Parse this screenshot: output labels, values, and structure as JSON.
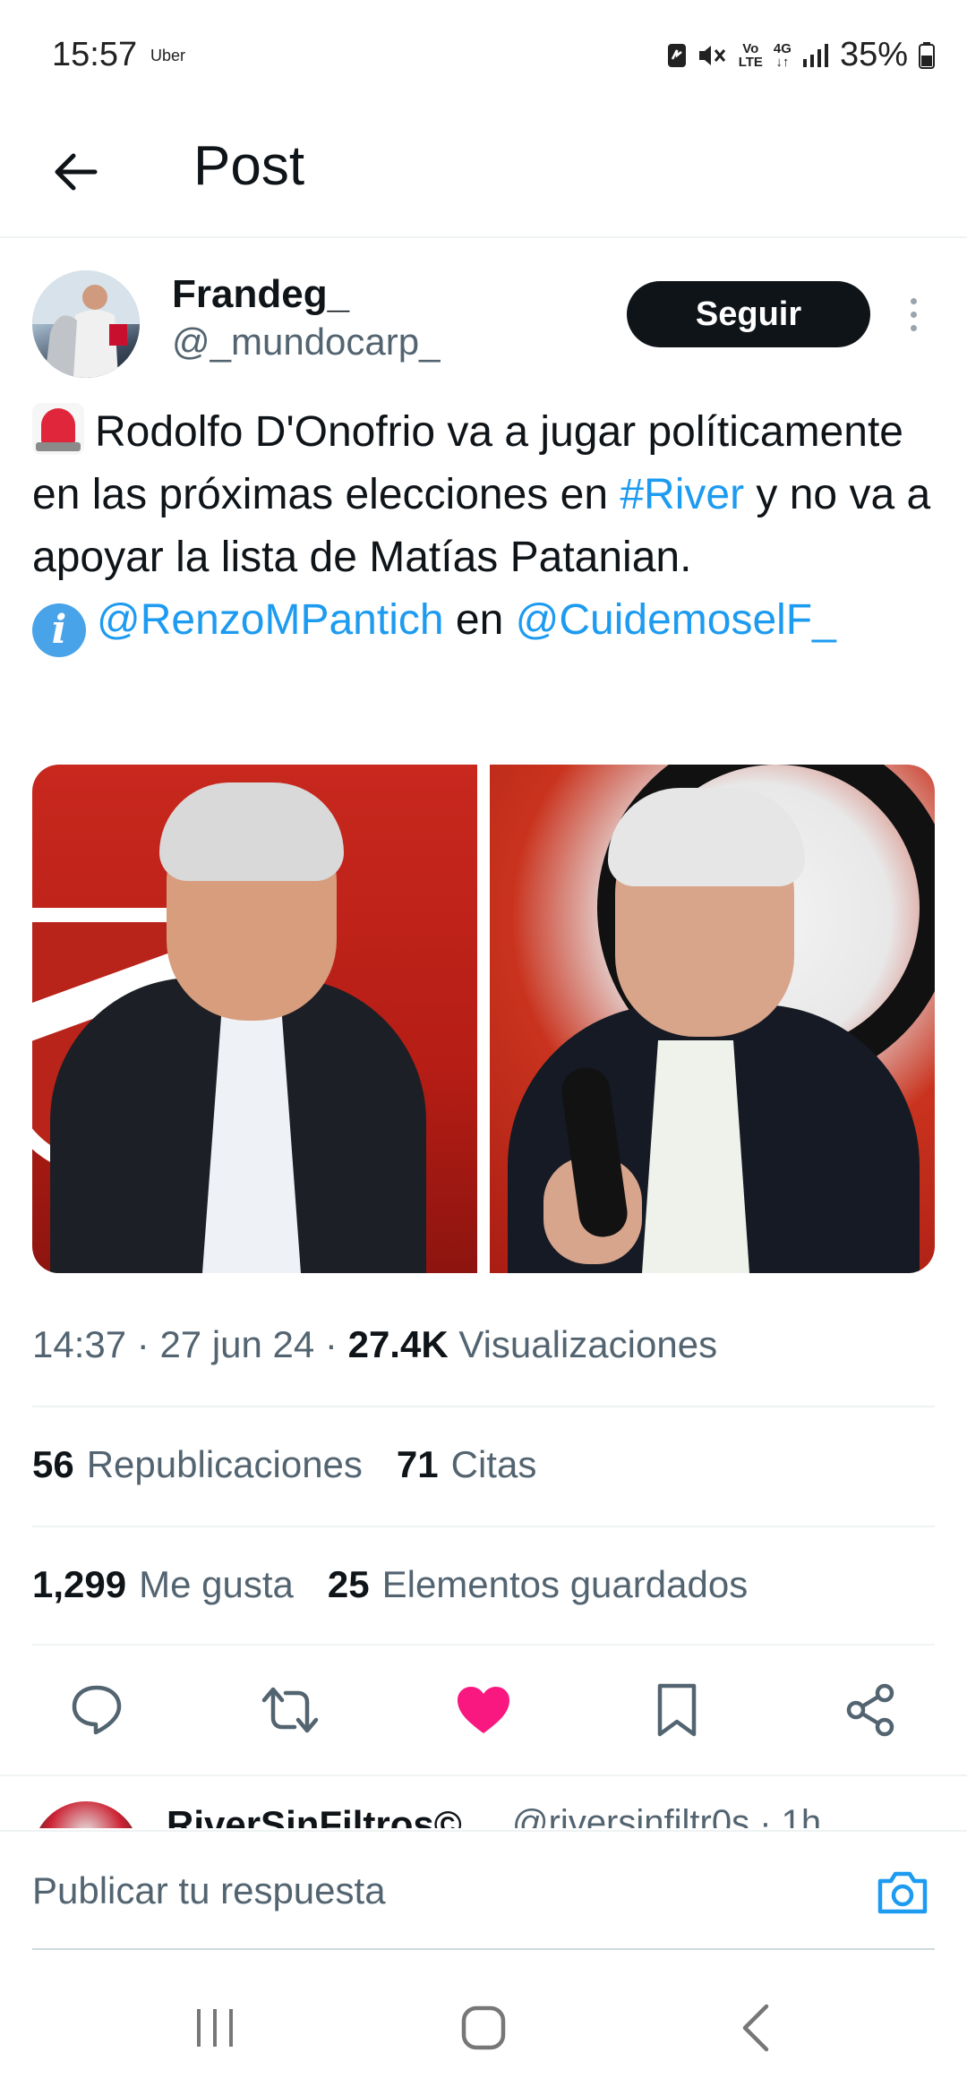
{
  "status_bar": {
    "time": "15:57",
    "app_label": "Uber",
    "volte_top": "Vo",
    "volte_bottom": "LTE",
    "network": "4G",
    "battery": "35%"
  },
  "top_bar": {
    "title": "Post",
    "back_icon": "arrow-left-icon"
  },
  "post": {
    "author_name": "Frandeg_",
    "author_handle": "@_mundocarp_",
    "follow_label": "Seguir",
    "text_part1": "Rodolfo D'Onofrio va a jugar políticamente en las próximas elecciones en ",
    "hashtag": "#River",
    "text_part2": " y no va a apoyar la lista de Matías Patanian.",
    "mention1": "@RenzoMPantich",
    "text_en": " en ",
    "mention2": "@CuidemoselF_",
    "emoji_1": "siren-emoji",
    "emoji_2": "info-emoji",
    "time": "14:37",
    "date": "27 jun 24",
    "views_count": "27.4K",
    "views_label": "Visualizaciones",
    "reposts_count": "56",
    "reposts_label": "Republicaciones",
    "quotes_count": "71",
    "quotes_label": "Citas",
    "likes_count": "1,299",
    "likes_label": "Me gusta",
    "bookmarks_count": "25",
    "bookmarks_label": "Elementos guardados"
  },
  "actions": {
    "reply_icon": "comment-icon",
    "repost_icon": "repost-icon",
    "like_icon": "heart-icon",
    "bookmark_icon": "bookmark-icon",
    "share_icon": "share-icon",
    "like_color": "#f91880"
  },
  "reply_peek": {
    "name": "RiverSinFiltros©",
    "handle_time": "@riversinfiltr0s · 1h"
  },
  "compose": {
    "placeholder": "Publicar tu respuesta",
    "camera_icon": "camera-icon",
    "accent": "#1d9bf0"
  },
  "nav_bar": {
    "recents_icon": "recents-icon",
    "home_icon": "home-icon",
    "back_icon": "nav-back-icon"
  }
}
